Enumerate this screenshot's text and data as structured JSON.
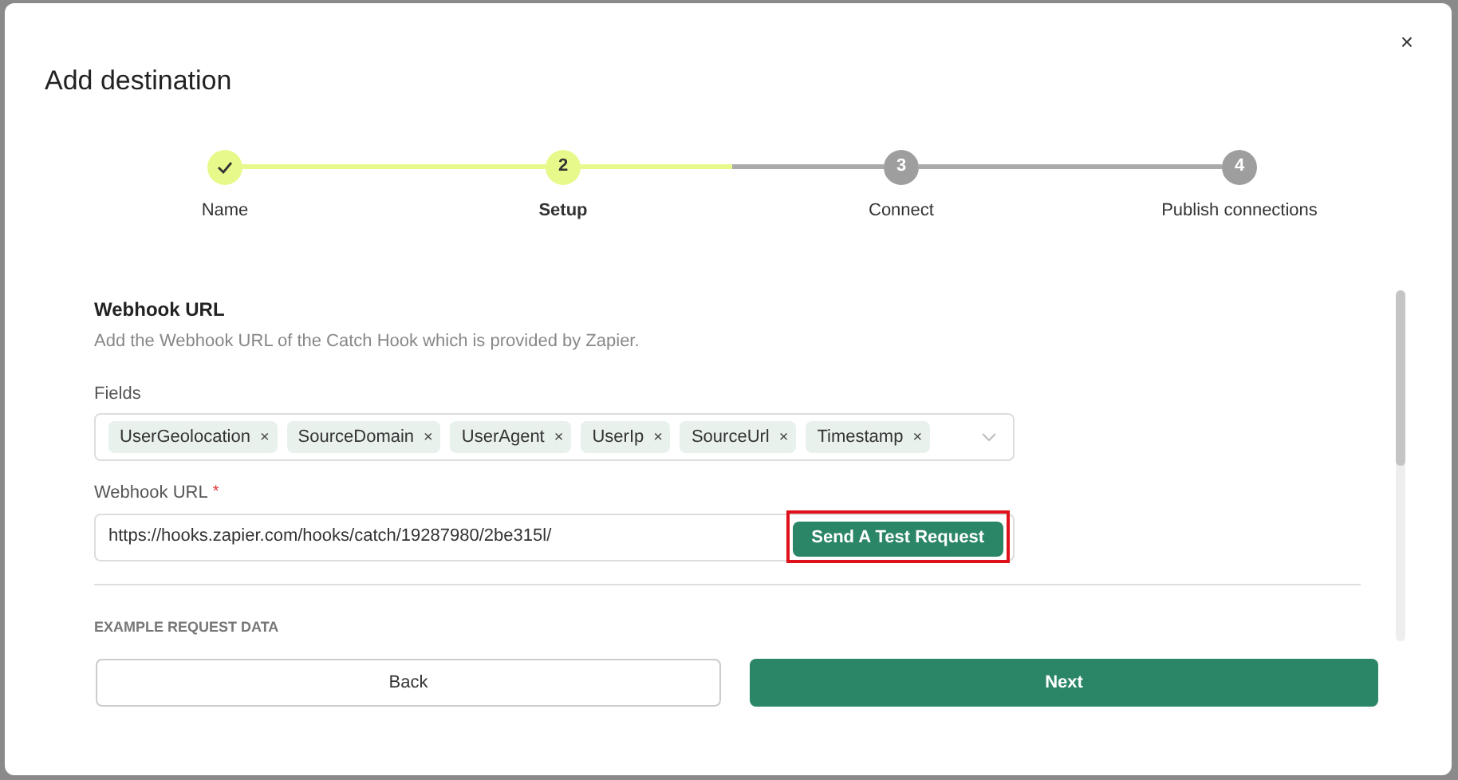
{
  "dialog": {
    "title": "Add destination",
    "close": "×"
  },
  "steps": [
    {
      "label": "Name",
      "completed": true,
      "selected": false
    },
    {
      "label": "Setup",
      "marker": "2",
      "completed": false,
      "selected": true
    },
    {
      "label": "Connect",
      "marker": "3",
      "completed": false,
      "selected": false
    },
    {
      "label": "Publish connections",
      "marker": "4",
      "completed": false,
      "selected": false
    }
  ],
  "section": {
    "title": "Webhook URL",
    "description": "Add the Webhook URL of the Catch Hook which is provided by Zapier."
  },
  "fields": {
    "label": "Fields",
    "tags": [
      "UserGeolocation",
      "SourceDomain",
      "UserAgent",
      "UserIp",
      "SourceUrl",
      "Timestamp"
    ],
    "remove": "×"
  },
  "webhook": {
    "label": "Webhook URL",
    "required_mark": "*",
    "value": "https://hooks.zapier.com/hooks/catch/19287980/2be315l/",
    "test_button": "Send A Test Request",
    "highlighted": true
  },
  "example": {
    "heading": "EXAMPLE REQUEST DATA"
  },
  "buttons": {
    "back": "Back",
    "next": "Next"
  }
}
